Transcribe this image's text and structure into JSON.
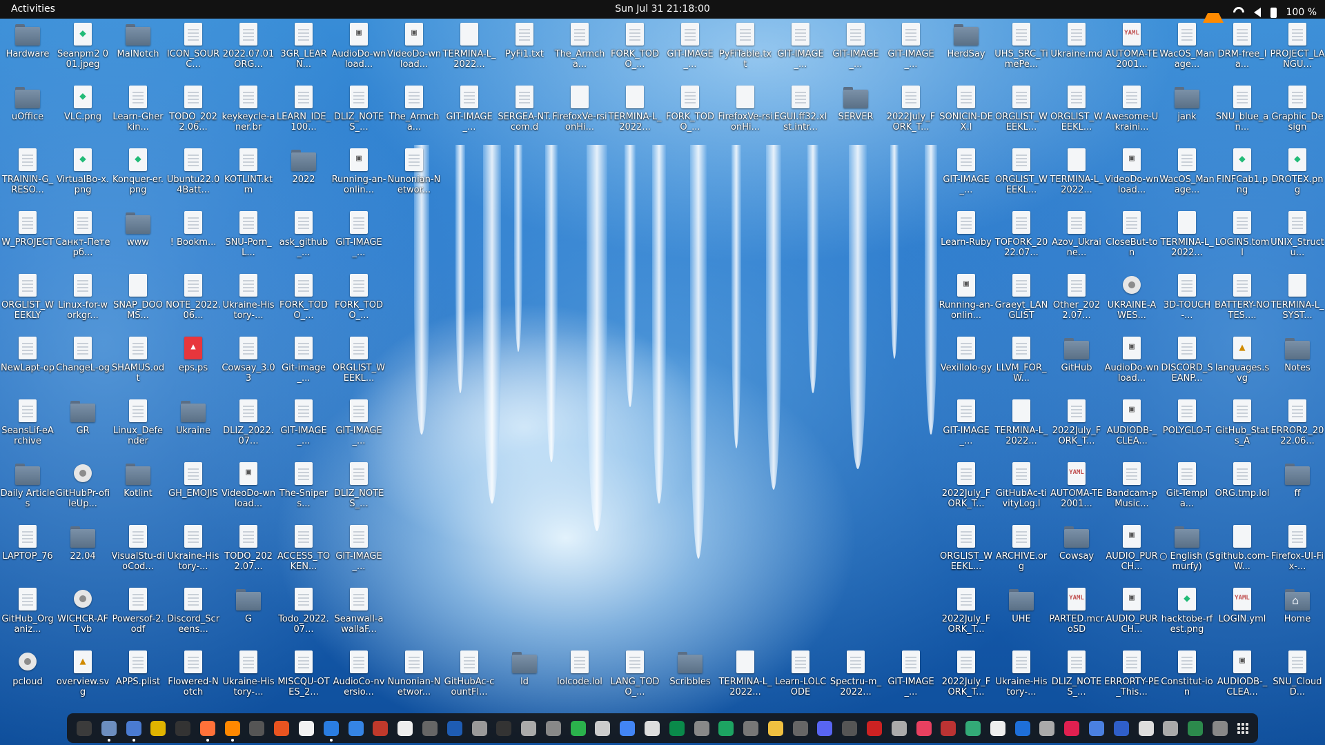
{
  "topbar": {
    "activities": "Activities",
    "clock": "Sun Jul 31  21:18:00",
    "battery": "100 %",
    "tray_icons": [
      "vlc-icon",
      "wifi-icon",
      "volume-icon",
      "battery-icon"
    ]
  },
  "desktop": {
    "columns": [
      [
        "Hardware",
        "uOffice",
        "TRAININ-G_RESO...",
        "W_PROJECT",
        "ORGLIST_WEEKLY",
        "NewLapt-op",
        "SeansLif-eArchive",
        "Daily Articles",
        "LAPTOP_76",
        "GitHub_Organiz...",
        "pcloud"
      ],
      [
        "Seanpm2 001.jpeg",
        "VLC.png",
        "VirtualBo-x.png",
        "Санкт-Петерб...",
        "Linux-for-workgr...",
        "ChangeL-og",
        "GR",
        "GitHubPr-ofileUp...",
        "22.04",
        "WICHCR-AFT.vb",
        "overview.svg"
      ],
      [
        "MalNotch",
        "Learn-Gherkin...",
        "Konquer-er.png",
        "www",
        "SNAP_DOOMS...",
        "SHAMUS.odt",
        "Linux_Defender",
        "Kotlint",
        "VisualStu-dioCod...",
        "Powersof-2.odf",
        "APPS.plist"
      ],
      [
        "ICON_SOURC...",
        "TODO_2022.06...",
        "Ubuntu22.04Batt...",
        "! Bookm...",
        "NOTE_2022.06...",
        "eps.ps",
        "Ukraine",
        "GH_EMOJIS",
        "Ukraine-History-...",
        "Discord_Screens...",
        "Flowered-Notch"
      ],
      [
        "2022.07.01ORG...",
        "keykeycle-aner.br",
        "KOTLINT.ktm",
        "SNU-Porn_L...",
        "Ukraine-History-...",
        "Cowsay_3.03",
        "DLIZ_2022.07...",
        "VideoDo-wnload...",
        "TODO_2022.07...",
        "G",
        "Ukraine-History-..."
      ],
      [
        "3GR_LEARN...",
        "LEARN_IDE_100...",
        "2022",
        "ask_github_...",
        "FORK_TODO_...",
        "Git-image_...",
        "GIT-IMAGE_...",
        "The-Snipers...",
        "ACCESS_TOKEN...",
        "Todo_2022.07...",
        "MISCQU-OTES_2..."
      ],
      [
        "AudioDo-wnload...",
        "DLIZ_NOTES_...",
        "Running-an-onlin...",
        "GIT-IMAGE_...",
        "FORK_TODO_...",
        "ORGLIST_WEEKL...",
        "GIT-IMAGE_...",
        "DLIZ_NOTES_...",
        "GIT-IMAGE_...",
        "Seanwall-awallaF...",
        "AudioCo-nversio..."
      ],
      [
        "VideoDo-wnload...",
        "The_Armcha...",
        "Nunonian-Networ...",
        "",
        "",
        "",
        "",
        "",
        "",
        "",
        "Nunonian-Networ..."
      ],
      [
        "TERMINA-L_2022...",
        "GIT-IMAGE_...",
        "",
        "",
        "",
        "",
        "",
        "",
        "",
        "",
        "GitHubAc-countFl..."
      ],
      [
        "PyFi1.txt",
        "SERGEA-NT.com.d",
        "",
        "",
        "",
        "",
        "",
        "",
        "",
        "",
        "ld"
      ],
      [
        "The_Armcha...",
        "FirefoxVe-rsionHi...",
        "",
        "",
        "",
        "",
        "",
        "",
        "",
        "",
        "lolcode.lol"
      ],
      [
        "FORK_TODO_...",
        "TERMINA-L_2022...",
        "",
        "",
        "",
        "",
        "",
        "",
        "",
        "",
        "LANG_TODO_..."
      ],
      [
        "GIT-IMAGE_...",
        "FORK_TODO_...",
        "",
        "",
        "",
        "",
        "",
        "",
        "",
        "",
        "Scribbles"
      ],
      [
        "PyFiTable.txt",
        "FirefoxVe-rsionHi...",
        "",
        "",
        "",
        "",
        "",
        "",
        "",
        "",
        "TERMINA-L_2022..."
      ],
      [
        "GIT-IMAGE_...",
        "EGUI.ff32.xlst.intr...",
        "",
        "",
        "",
        "",
        "",
        "",
        "",
        "",
        "Learn-LOLCODE"
      ],
      [
        "GIT-IMAGE_...",
        "SERVER",
        "",
        "",
        "",
        "",
        "",
        "",
        "",
        "",
        "Spectru-m_2022..."
      ],
      [
        "GIT-IMAGE_...",
        "2022July_FORK_T...",
        "",
        "",
        "",
        "",
        "",
        "",
        "",
        "",
        "GIT-IMAGE_..."
      ],
      [
        "HerdSay",
        "SONICIN-DEX.l",
        "GIT-IMAGE_...",
        "Learn-Ruby",
        "Running-an-onlin...",
        "Vexillolo-gy",
        "GIT-IMAGE_...",
        "2022July_FORK_T...",
        "ORGLIST_WEEKL...",
        "2022July_FORK_T...",
        "2022July_FORK_T..."
      ],
      [
        "UHS_SRC_TimePe...",
        "ORGLIST_WEEKL...",
        "ORGLIST_WEEKL...",
        "TOFORK_2022.07...",
        "Graeyt_LANGLIST",
        "LLVM_FOR_W...",
        "TERMINA-L_2022...",
        "GitHubAc-tivityLog.l",
        "ARCHIVE.org",
        "UHE",
        "Ukraine-History-..."
      ],
      [
        "Ukraine.md",
        "ORGLIST_WEEKL...",
        "TERMINA-L_2022...",
        "Azov_Ukraine...",
        "Other_2022.07...",
        "GitHub",
        "2022July_FORK_T...",
        "AUTOMA-TE2001...",
        "Cowsay",
        "PARTED.mcroSD",
        "DLIZ_NOTES_..."
      ],
      [
        "AUTOMA-TE2001...",
        "Awesome-Ukraini...",
        "VideoDo-wnload...",
        "CloseBut-ton",
        "UKRAINE-AWES...",
        "AudioDo-wnload...",
        "AUDIODB-_CLEA...",
        "Bandcam-pMusic...",
        "AUDIO_PURCH...",
        "AUDIO_PURCH...",
        "ERRORTY-PE_This..."
      ],
      [
        "WacOS_Manage...",
        "jank",
        "WacOS_Manage...",
        "TERMINA-L_2022...",
        "3D-TOUCH-...",
        "DISCORD_SEANP...",
        "POLYGLO-T",
        "Git-Templa...",
        "○ English (Smurfy)",
        "hacktobe-rfest.png",
        "Constitut-ion"
      ],
      [
        "DRM-free_la...",
        "SNU_blue_an...",
        "FINFCab1.png",
        "LOGINS.toml",
        "BATTERY-NOTES....",
        "languages.svg",
        "GitHub_Stats_A",
        "ORG.tmp.lol",
        "github.com-W...",
        "LOGIN.yml",
        "AUDIODB-_CLEA..."
      ],
      [
        "PROJECT_LANGU...",
        "Graphic_Design",
        "DROTEX.png",
        "UNIX_Structu...",
        "TERMINA-L_SYST...",
        "Notes",
        "ERROR2_2022.06...",
        "ff",
        "Firefox-UI-Fix-...",
        "Home",
        "SNU_CloudD..."
      ]
    ]
  },
  "dock": {
    "apps": [
      "terminal-icon",
      "files-icon",
      "text-editor-icon",
      "archive-icon",
      "terminal2-icon",
      "firefox-icon",
      "vlc-icon",
      "obs-icon",
      "software-icon",
      "notes-icon",
      "writer-icon",
      "help-icon",
      "monitor-icon",
      "document-icon",
      "gnome-icon",
      "virtualbox-icon",
      "settings-icon",
      "inkscape-icon",
      "app1-icon",
      "app2-icon",
      "calc-icon",
      "search-icon",
      "chrome-icon",
      "app3-icon",
      "app4-icon",
      "app5-icon",
      "spreadsheet-icon",
      "app6-icon",
      "app7-icon",
      "app8-icon",
      "discord-icon",
      "app9-icon",
      "app10-icon",
      "app11-icon",
      "app12-icon",
      "app13-icon",
      "app14-icon",
      "app15-icon",
      "app16-icon",
      "app17-icon",
      "app18-icon",
      "app19-icon",
      "app20-icon",
      "app21-icon",
      "app22-icon",
      "app23-icon",
      "app24-icon",
      "show-apps-icon"
    ]
  }
}
